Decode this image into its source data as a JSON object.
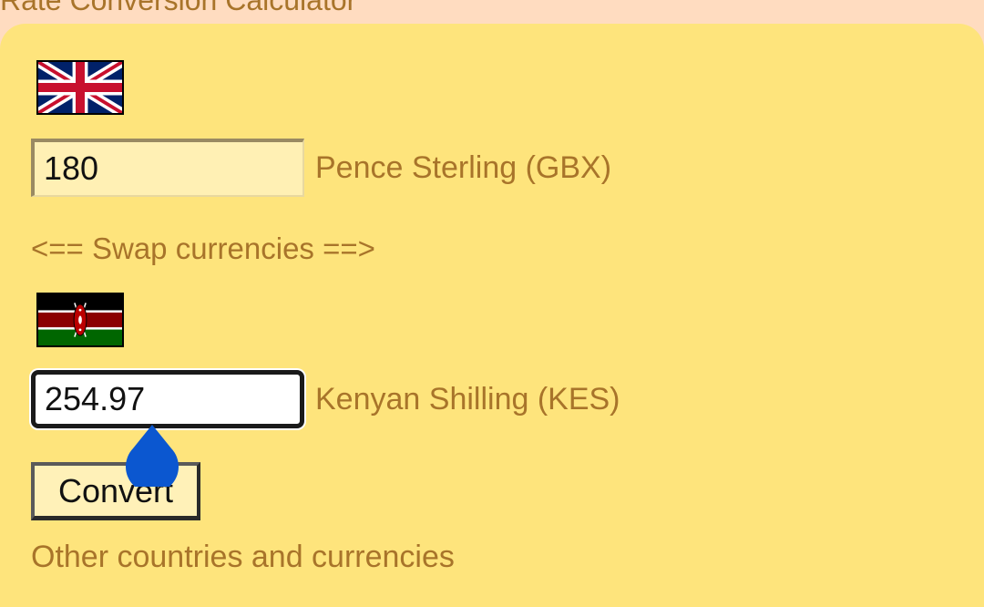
{
  "header": {
    "title": "Rate Conversion Calculator"
  },
  "from": {
    "flag_icon": "uk-flag-icon",
    "amount": "180",
    "currency_label": "Pence Sterling (GBX)"
  },
  "swap": {
    "label": "<== Swap currencies ==>"
  },
  "to": {
    "flag_icon": "kenya-flag-icon",
    "amount": "254.97",
    "currency_label": "Kenyan Shilling (KES)"
  },
  "actions": {
    "convert_label": "Convert"
  },
  "footer": {
    "other_link": "Other countries and currencies"
  },
  "colors": {
    "page_background": "#ffdcc0",
    "card_background": "#fee47c",
    "label_text": "#a8742a",
    "text_cursor_handle": "#0b57d0"
  }
}
